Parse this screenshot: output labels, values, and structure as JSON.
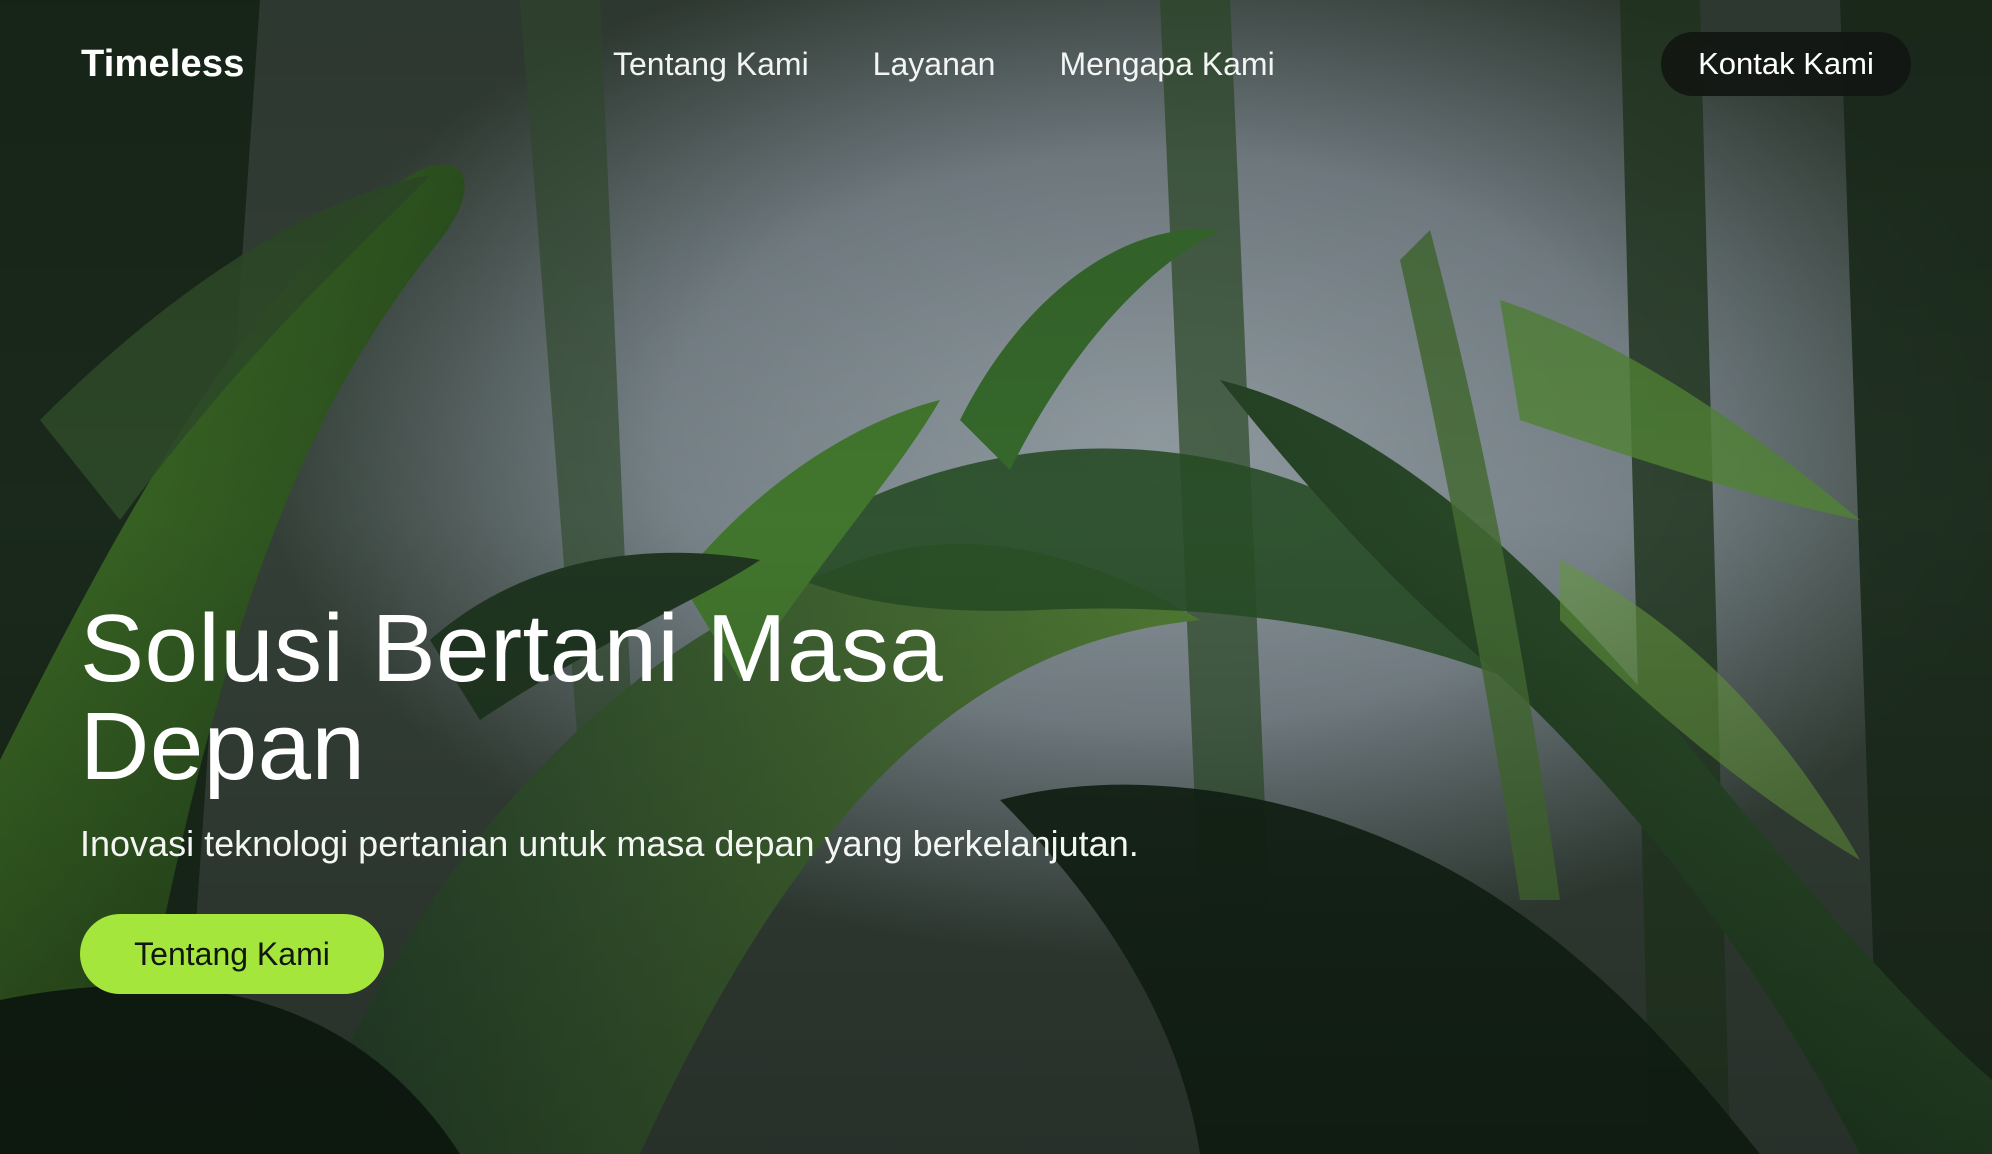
{
  "header": {
    "brand": "Timeless",
    "nav": [
      {
        "label": "Tentang Kami"
      },
      {
        "label": "Layanan"
      },
      {
        "label": "Mengapa Kami"
      }
    ],
    "contact_label": "Kontak Kami"
  },
  "hero": {
    "title": "Solusi Bertani Masa Depan",
    "subtitle": "Inovasi teknologi pertanian untuk masa depan yang berkelanjutan.",
    "cta_label": "Tentang Kami",
    "background_icon": "corn-field-photo"
  },
  "colors": {
    "accent": "#a4e63c",
    "contact_button": "#121612",
    "text": "#ffffff"
  }
}
